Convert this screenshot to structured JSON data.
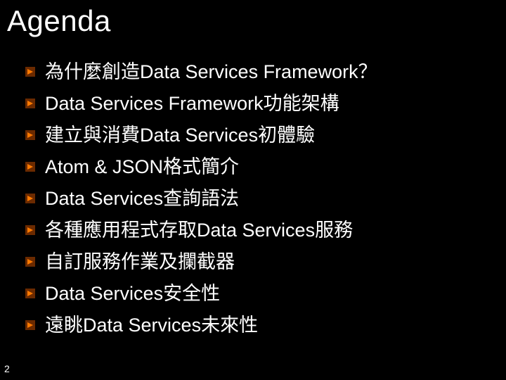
{
  "title": "Agenda",
  "items": [
    "為什麼創造Data Services Framework？",
    "Data Services Framework功能架構",
    "建立與消費Data Services初體驗",
    "Atom & JSON格式簡介",
    "Data Services查詢語法",
    "各種應用程式存取Data Services服務",
    "自訂服務作業及攔截器",
    "Data Services安全性",
    "遠眺Data Services未來性"
  ],
  "page_number": "2"
}
